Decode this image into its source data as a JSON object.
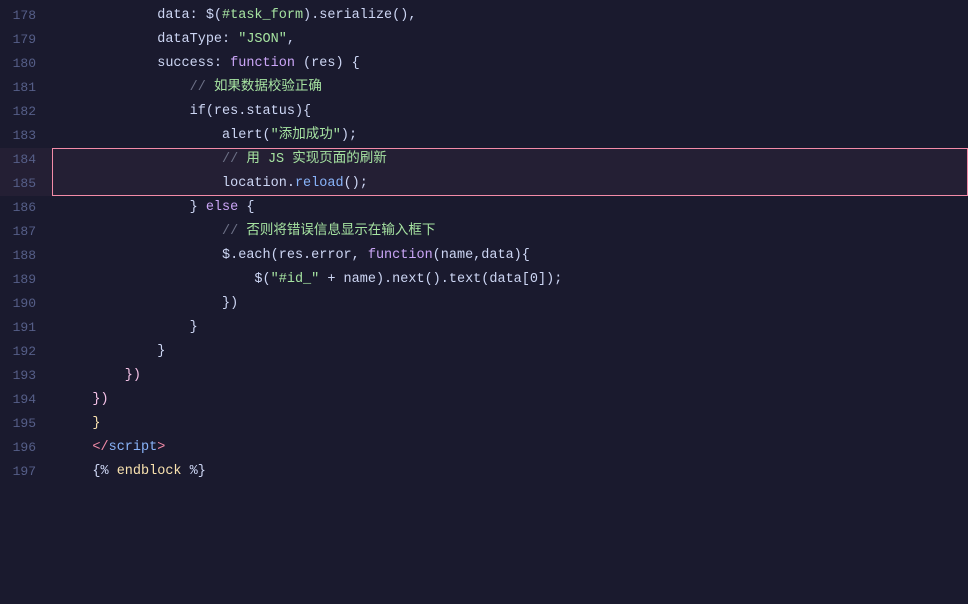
{
  "editor": {
    "background": "#1a1a2e",
    "lines": [
      {
        "number": "178",
        "tokens": [
          {
            "text": "            data: $(",
            "class": "white"
          },
          {
            "text": "#task_form",
            "class": "str"
          },
          {
            "text": ").serialize(),",
            "class": "white"
          }
        ]
      },
      {
        "number": "179",
        "tokens": [
          {
            "text": "            dataType: ",
            "class": "white"
          },
          {
            "text": "\"JSON\"",
            "class": "str"
          },
          {
            "text": ",",
            "class": "white"
          }
        ]
      },
      {
        "number": "180",
        "tokens": [
          {
            "text": "            success: ",
            "class": "white"
          },
          {
            "text": "function",
            "class": "kw"
          },
          {
            "text": " (res) {",
            "class": "white"
          }
        ]
      },
      {
        "number": "181",
        "tokens": [
          {
            "text": "                // ",
            "class": "comment"
          },
          {
            "text": "如果数据校验正确",
            "class": "comment-cn"
          }
        ]
      },
      {
        "number": "182",
        "tokens": [
          {
            "text": "                if(res.status){",
            "class": "white"
          }
        ]
      },
      {
        "number": "183",
        "tokens": [
          {
            "text": "                    alert(",
            "class": "white"
          },
          {
            "text": "\"添加成功\"",
            "class": "str"
          },
          {
            "text": ");",
            "class": "white"
          }
        ]
      },
      {
        "number": "184",
        "tokens": [
          {
            "text": "                    // ",
            "class": "comment"
          },
          {
            "text": "用 JS 实现页面的刷新",
            "class": "comment-cn"
          }
        ],
        "highlighted": true
      },
      {
        "number": "185",
        "tokens": [
          {
            "text": "                    location.",
            "class": "white"
          },
          {
            "text": "reload",
            "class": "fn"
          },
          {
            "text": "();",
            "class": "white"
          }
        ],
        "highlighted": true,
        "highlightEnd": true
      },
      {
        "number": "186",
        "tokens": [
          {
            "text": "                } ",
            "class": "white"
          },
          {
            "text": "else",
            "class": "kw"
          },
          {
            "text": " {",
            "class": "white"
          }
        ]
      },
      {
        "number": "187",
        "tokens": [
          {
            "text": "                    // ",
            "class": "comment"
          },
          {
            "text": "否则将错误信息显示在输入框下",
            "class": "comment-cn"
          }
        ]
      },
      {
        "number": "188",
        "tokens": [
          {
            "text": "                    $.each(res.error, ",
            "class": "white"
          },
          {
            "text": "function",
            "class": "kw"
          },
          {
            "text": "(name,data){",
            "class": "white"
          }
        ]
      },
      {
        "number": "189",
        "tokens": [
          {
            "text": "                        $(",
            "class": "white"
          },
          {
            "text": "\"#id_\"",
            "class": "str"
          },
          {
            "text": " + name).next().text(data[0]);",
            "class": "white"
          }
        ]
      },
      {
        "number": "190",
        "tokens": [
          {
            "text": "                    })",
            "class": "white"
          }
        ]
      },
      {
        "number": "191",
        "tokens": [
          {
            "text": "                }",
            "class": "white"
          }
        ]
      },
      {
        "number": "192",
        "tokens": [
          {
            "text": "            }",
            "class": "white"
          }
        ]
      },
      {
        "number": "193",
        "tokens": [
          {
            "text": "        })",
            "class": "magenta"
          }
        ]
      },
      {
        "number": "194",
        "tokens": [
          {
            "text": "    })",
            "class": "magenta"
          }
        ]
      },
      {
        "number": "195",
        "tokens": [
          {
            "text": "    }",
            "class": "yellow"
          }
        ]
      },
      {
        "number": "196",
        "tokens": [
          {
            "text": "    ",
            "class": "white"
          },
          {
            "text": "</",
            "class": "tag"
          },
          {
            "text": "script",
            "class": "tag-name"
          },
          {
            "text": ">",
            "class": "tag"
          }
        ]
      },
      {
        "number": "197",
        "tokens": [
          {
            "text": "    ",
            "class": "white"
          },
          {
            "text": "{%",
            "class": "white"
          },
          {
            "text": " endblock ",
            "class": "yellow"
          },
          {
            "text": "%}",
            "class": "white"
          }
        ]
      }
    ]
  }
}
